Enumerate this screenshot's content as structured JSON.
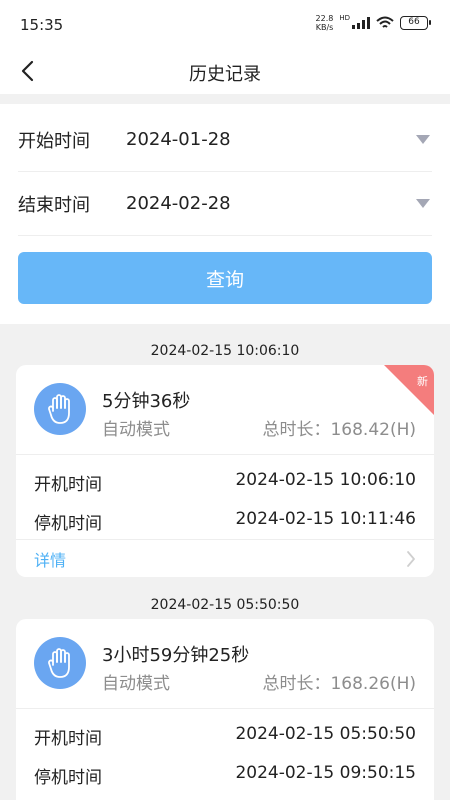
{
  "status_bar": {
    "time": "15:35",
    "net_speed_value": "22.8",
    "net_speed_unit": "KB/s",
    "network_label": "HD",
    "battery": "66"
  },
  "nav": {
    "title": "历史记录",
    "back_icon": "chevron-left-icon"
  },
  "filters": {
    "start_label": "开始时间",
    "start_value": "2024-01-28",
    "end_label": "结束时间",
    "end_value": "2024-02-28",
    "query_button": "查询"
  },
  "records": [
    {
      "group_date": "2024-02-15 10:06:10",
      "badge": "新",
      "duration": "5分钟36秒",
      "mode": "自动模式",
      "total": "总时长：168.42(H)",
      "start_label": "开机时间",
      "start_time": "2024-02-15 10:06:10",
      "stop_label": "停机时间",
      "stop_time": "2024-02-15 10:11:46",
      "detail_label": "详情",
      "icon": "hand-icon"
    },
    {
      "group_date": "2024-02-15 05:50:50",
      "duration": "3小时59分钟25秒",
      "mode": "自动模式",
      "total": "总时长：168.26(H)",
      "start_label": "开机时间",
      "start_time": "2024-02-15 05:50:50",
      "stop_label": "停机时间",
      "stop_time": "2024-02-15 09:50:15",
      "icon": "hand-icon"
    }
  ],
  "colors": {
    "accent": "#67b7f8",
    "link": "#4fb1f5",
    "badge": "#f47d7d",
    "avatar": "#6aa6f1",
    "background": "#f1f1f1"
  }
}
